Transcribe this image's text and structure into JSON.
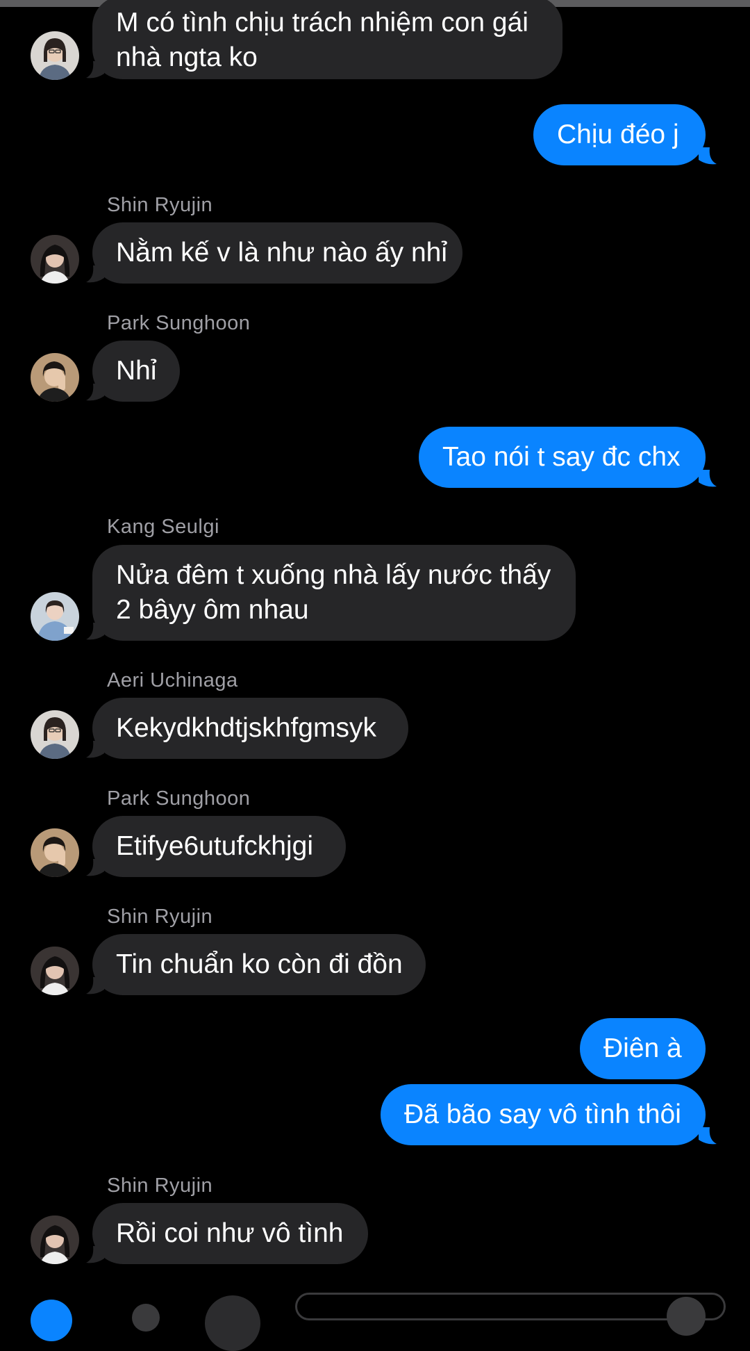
{
  "colors": {
    "background": "#000000",
    "incoming_bubble": "#262628",
    "outgoing_bubble": "#0a84ff",
    "sender_name": "#a0a0a6"
  },
  "messages": [
    {
      "direction": "in",
      "sender": "",
      "avatar": "aeri-avatar",
      "text_lines": [
        "M có tình chịu trách nhiệm con gái",
        "nhà ngta ko"
      ]
    },
    {
      "direction": "out",
      "text_lines": [
        "Chịu đéo j"
      ]
    },
    {
      "direction": "in",
      "sender": "Shin Ryujin",
      "avatar": "ryujin-avatar",
      "text_lines": [
        "Nằm kế v là như nào ấy nhỉ"
      ]
    },
    {
      "direction": "in",
      "sender": "Park Sunghoon",
      "avatar": "sunghoon-avatar",
      "text_lines": [
        "Nhỉ"
      ]
    },
    {
      "direction": "out",
      "text_lines": [
        "Tao nói t say đc chx"
      ]
    },
    {
      "direction": "in",
      "sender": "Kang Seulgi",
      "avatar": "seulgi-avatar",
      "text_lines": [
        "Nửa đêm t xuống nhà lấy nước thấy",
        "2 bâyy ôm nhau"
      ]
    },
    {
      "direction": "in",
      "sender": "Aeri Uchinaga",
      "avatar": "aeri-avatar",
      "text_lines": [
        "Kekydkhdtjskhfgmsyk"
      ]
    },
    {
      "direction": "in",
      "sender": "Park Sunghoon",
      "avatar": "sunghoon-avatar",
      "text_lines": [
        "Etifye6utufckhjgi"
      ]
    },
    {
      "direction": "in",
      "sender": "Shin Ryujin",
      "avatar": "ryujin-avatar",
      "text_lines": [
        "Tin chuẩn ko còn đi đồn"
      ]
    },
    {
      "direction": "out",
      "text_lines": [
        "Điên à"
      ]
    },
    {
      "direction": "out",
      "text_lines": [
        "Đã bão say vô tình thôi"
      ]
    },
    {
      "direction": "in",
      "sender": "Shin Ryujin",
      "avatar": "ryujin-avatar",
      "text_lines": [
        "Rồi coi như vô tình"
      ]
    }
  ],
  "composer": {
    "icons": [
      "camera-icon",
      "photo-icon"
    ],
    "field_placeholder": ""
  }
}
